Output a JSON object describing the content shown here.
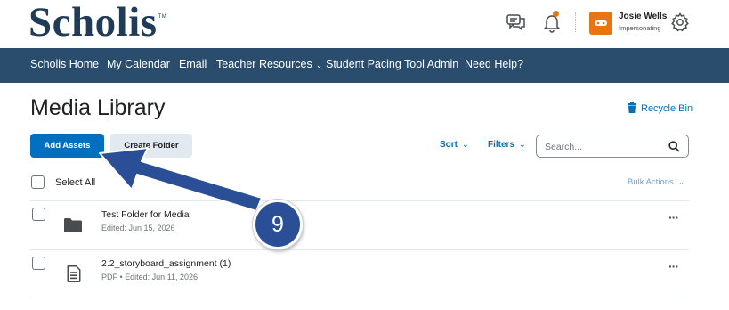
{
  "header": {
    "logo_text": "Scholis",
    "logo_mark": "TM",
    "user_name": "Josie Wells",
    "user_status": "Impersonating",
    "notification_dot_color": "#e87511",
    "avatar_color": "#e87511",
    "icons": [
      "chat-icon",
      "bell-icon",
      "gear-icon"
    ]
  },
  "nav": {
    "items": [
      {
        "label": "Scholis Home"
      },
      {
        "label": "My Calendar"
      },
      {
        "label": "Email"
      },
      {
        "label": "Teacher Resources",
        "has_dropdown": true
      },
      {
        "label": "Student Pacing Tool Admin"
      },
      {
        "label": "Need Help?"
      }
    ],
    "background": "#2a4d6e"
  },
  "main": {
    "title": "Media Library",
    "recycle_bin": "Recycle Bin",
    "add_assets": "Add Assets",
    "create_folder": "Create Folder",
    "sort": "Sort",
    "filters": "Filters",
    "search_placeholder": "Search...",
    "select_all": "Select All",
    "bulk_actions": "Bulk Actions",
    "accent": "#006fbf"
  },
  "items": [
    {
      "title": "Test Folder for Media",
      "meta": "Edited: Jun 15, 2026",
      "icon": "folder-icon"
    },
    {
      "title": "2.2_storyboard_assignment (1)",
      "type": "PDF",
      "meta": "Edited: Jun 11, 2026",
      "icon": "document-icon"
    }
  ],
  "annotation": {
    "step_number": "9",
    "color": "#2a4f97"
  }
}
